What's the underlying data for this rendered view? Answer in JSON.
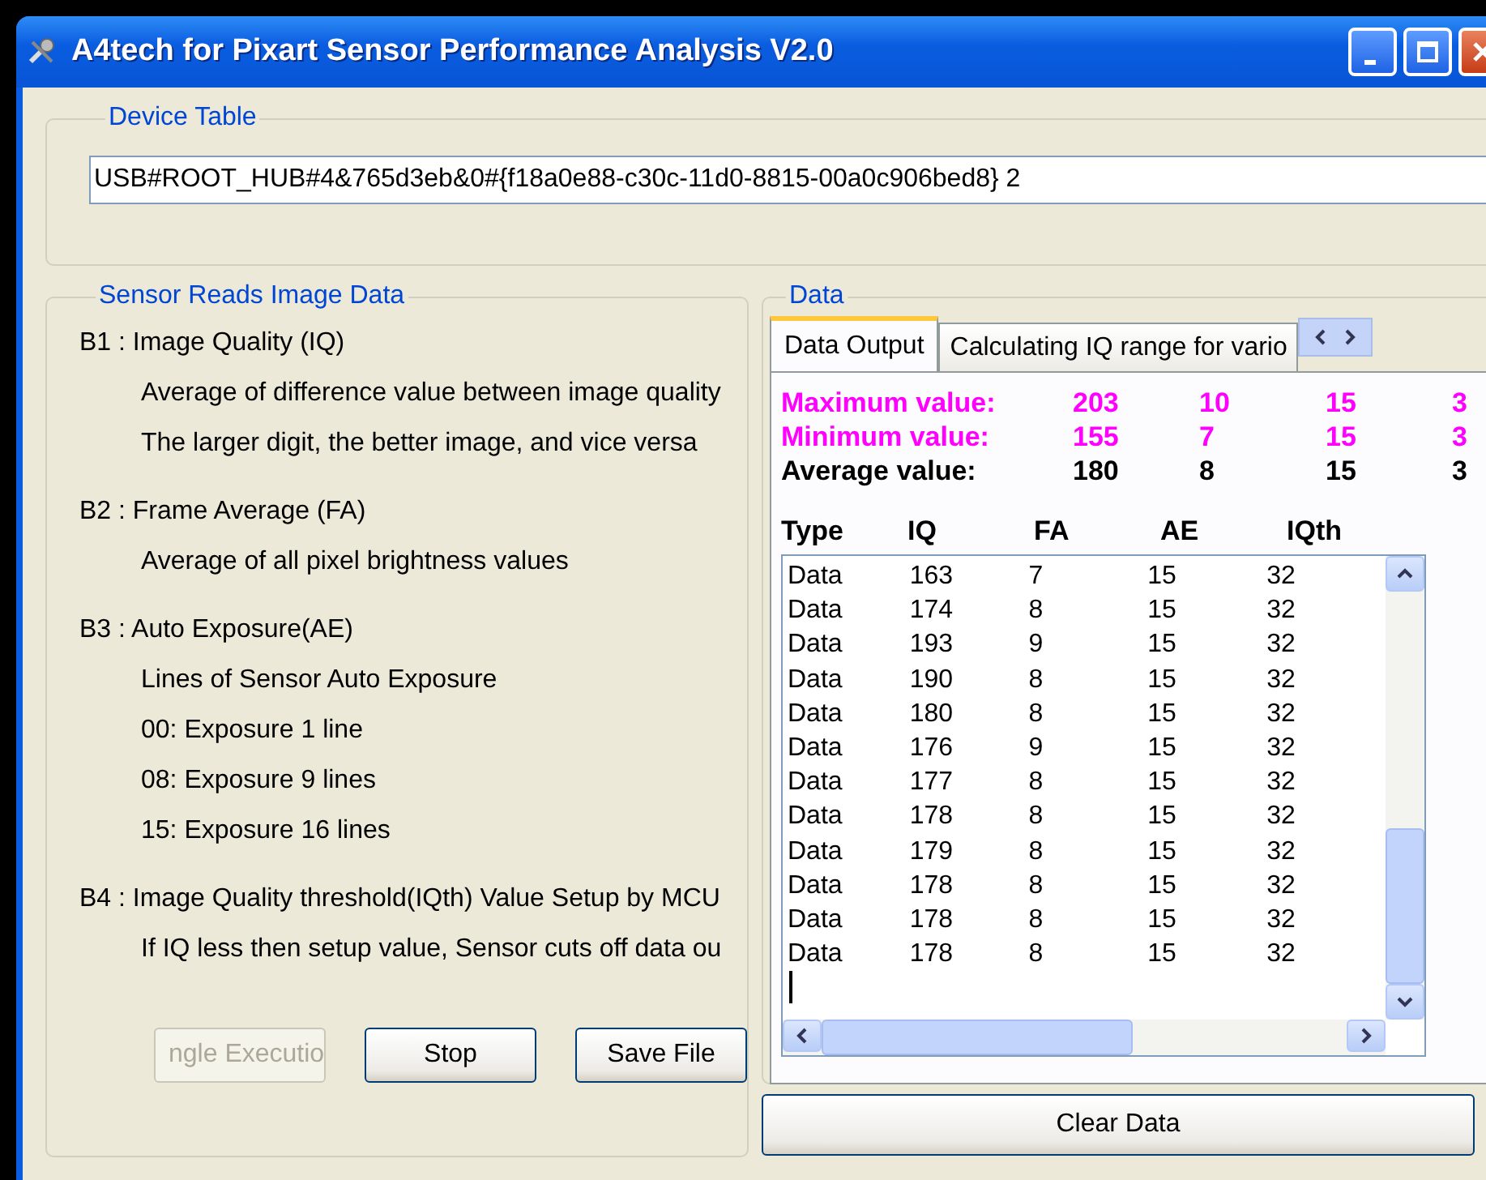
{
  "window": {
    "title": "A4tech for Pixart Sensor Performance Analysis V2.0"
  },
  "device_table": {
    "title": "Device Table",
    "value": "USB#ROOT_HUB#4&765d3eb&0#{f18a0e88-c30c-11d0-8815-00a0c906bed8} 2"
  },
  "sensor_group": {
    "title": "Sensor Reads Image Data",
    "sections": [
      {
        "heading": "B1 : Image Quality (IQ)",
        "lines": [
          "Average of difference value between image quality",
          "The larger digit, the better image, and vice versa"
        ]
      },
      {
        "heading": "B2 : Frame Average (FA)",
        "lines": [
          "Average of all pixel brightness values"
        ]
      },
      {
        "heading": "B3 : Auto Exposure(AE)",
        "lines": [
          "Lines of Sensor Auto Exposure",
          "00: Exposure 1 line",
          "08: Exposure 9 lines",
          "15: Exposure 16 lines"
        ]
      },
      {
        "heading": "B4 : Image Quality threshold(IQth) Value Setup by MCU",
        "lines": [
          "If IQ less then setup value, Sensor cuts off data ou"
        ]
      }
    ],
    "buttons": [
      {
        "label": "ngle Executio",
        "disabled": true
      },
      {
        "label": "Stop",
        "disabled": false
      },
      {
        "label": "Save File",
        "disabled": false
      }
    ]
  },
  "data_group": {
    "title": "Data",
    "tabs": [
      {
        "label": "Data Output",
        "selected": true
      },
      {
        "label": "Calculating IQ range for vario",
        "selected": false
      }
    ],
    "summary": [
      {
        "label": "Maximum value:",
        "values": [
          "203",
          "10",
          "15",
          "3"
        ],
        "color": "#ff00ff"
      },
      {
        "label": "Minimum value:",
        "values": [
          "155",
          "7",
          "15",
          "3"
        ],
        "color": "#ff00ff"
      },
      {
        "label": "Average value:",
        "values": [
          "180",
          "8",
          "15",
          "3"
        ],
        "color": "#000000"
      }
    ],
    "columns": [
      "Type",
      "IQ",
      "FA",
      "AE",
      "IQth"
    ],
    "rows": [
      [
        "Data",
        "163",
        "7",
        "15",
        "32"
      ],
      [
        "Data",
        "174",
        "8",
        "15",
        "32"
      ],
      [
        "Data",
        "193",
        "9",
        "15",
        "32"
      ],
      [
        "Data",
        "190",
        "8",
        "15",
        "32"
      ],
      [
        "Data",
        "180",
        "8",
        "15",
        "32"
      ],
      [
        "Data",
        "176",
        "9",
        "15",
        "32"
      ],
      [
        "Data",
        "177",
        "8",
        "15",
        "32"
      ],
      [
        "Data",
        "178",
        "8",
        "15",
        "32"
      ],
      [
        "Data",
        "179",
        "8",
        "15",
        "32"
      ],
      [
        "Data",
        "178",
        "8",
        "15",
        "32"
      ],
      [
        "Data",
        "178",
        "8",
        "15",
        "32"
      ],
      [
        "Data",
        "178",
        "8",
        "15",
        "32"
      ]
    ],
    "clear_button": "Clear Data"
  }
}
